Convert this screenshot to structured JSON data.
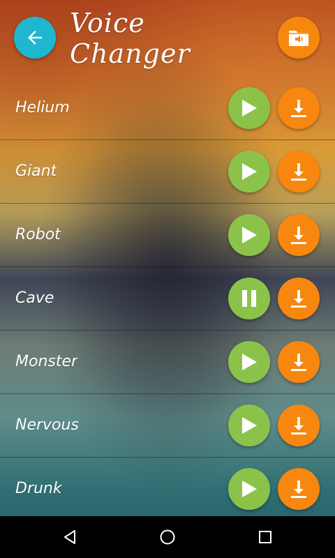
{
  "header": {
    "title": "Voice Changer",
    "back_icon": "arrow-left-icon",
    "folder_icon": "folder-sound-icon"
  },
  "colors": {
    "back_button": "#1fb6d0",
    "play_button": "#8bc34a",
    "download_button": "#f7870f",
    "folder_button": "#f7870f",
    "navbar": "#000000"
  },
  "effects": [
    {
      "label": "Helium",
      "state": "stopped"
    },
    {
      "label": "Giant",
      "state": "stopped"
    },
    {
      "label": "Robot",
      "state": "stopped"
    },
    {
      "label": "Cave",
      "state": "playing"
    },
    {
      "label": "Monster",
      "state": "stopped"
    },
    {
      "label": "Nervous",
      "state": "stopped"
    },
    {
      "label": "Drunk",
      "state": "stopped"
    }
  ],
  "navbar": {
    "back_icon": "nav-back-triangle-icon",
    "home_icon": "nav-home-circle-icon",
    "recents_icon": "nav-recents-square-icon"
  }
}
